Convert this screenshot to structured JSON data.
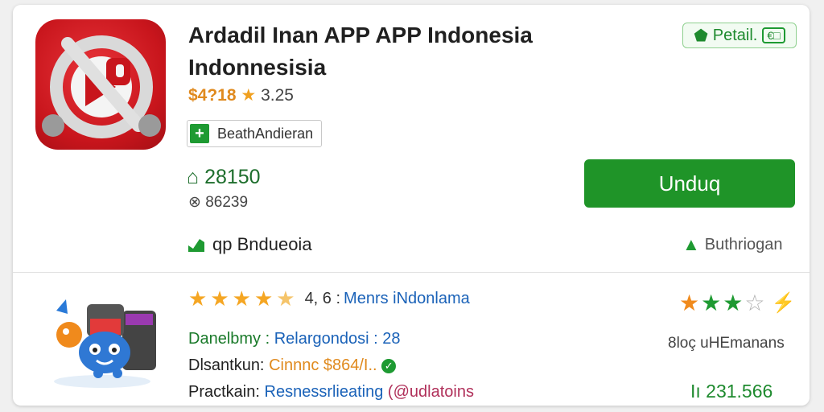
{
  "app": {
    "title_line1": "Ardadil Inan APP APP Indonesia",
    "title_line2": "Indonnesisia",
    "price": "$4?18",
    "rating": "3.25",
    "tag_label": "BeathAndieran",
    "stat_primary": "28150",
    "stat_secondary": "86239",
    "detail_button": "Petail.",
    "detail_chip": "€□",
    "download_button": "Unduq",
    "feature_left": "qp Bndueoia",
    "feature_right": "Buthriogan"
  },
  "review": {
    "rating_text": "4, 6 :",
    "rating_link": "Menrs iNdonlama",
    "line1_label": "Danelbmy :",
    "line1_value": "Relargondosi : 28",
    "line2_label": "Dlsantkun:",
    "line2_value": "Cinnnc $864/I..",
    "line3_label": "Practkain:",
    "line3_value": "Resnessrlieating",
    "line3_handle": "(@udlatoins",
    "right_label": "8loç uHEmanans",
    "right_number": "Iı 231.566"
  },
  "colors": {
    "accent_green": "#1f9428",
    "price_orange": "#e08a1e",
    "link_blue": "#1a62b8",
    "icon_red": "#c8151c"
  }
}
